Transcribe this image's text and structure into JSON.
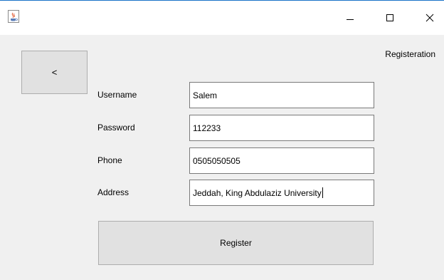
{
  "window": {
    "minimize_icon": "minimize-icon",
    "maximize_icon": "maximize-icon",
    "close_icon": "close-icon",
    "app_icon": "java-cup-icon"
  },
  "screen": {
    "title": "Registeration",
    "back_label": "<"
  },
  "form": {
    "fields": [
      {
        "label": "Username",
        "value": "Salem"
      },
      {
        "label": "Password",
        "value": "112233"
      },
      {
        "label": "Phone",
        "value": "0505050505"
      },
      {
        "label": "Address",
        "value": "Jeddah, King Abdulaziz University"
      }
    ],
    "submit_label": "Register"
  },
  "colors": {
    "background": "#f0f0f0",
    "titlebar": "#ffffff",
    "button_face": "#e1e1e1",
    "field_border": "#7a7a7a"
  }
}
